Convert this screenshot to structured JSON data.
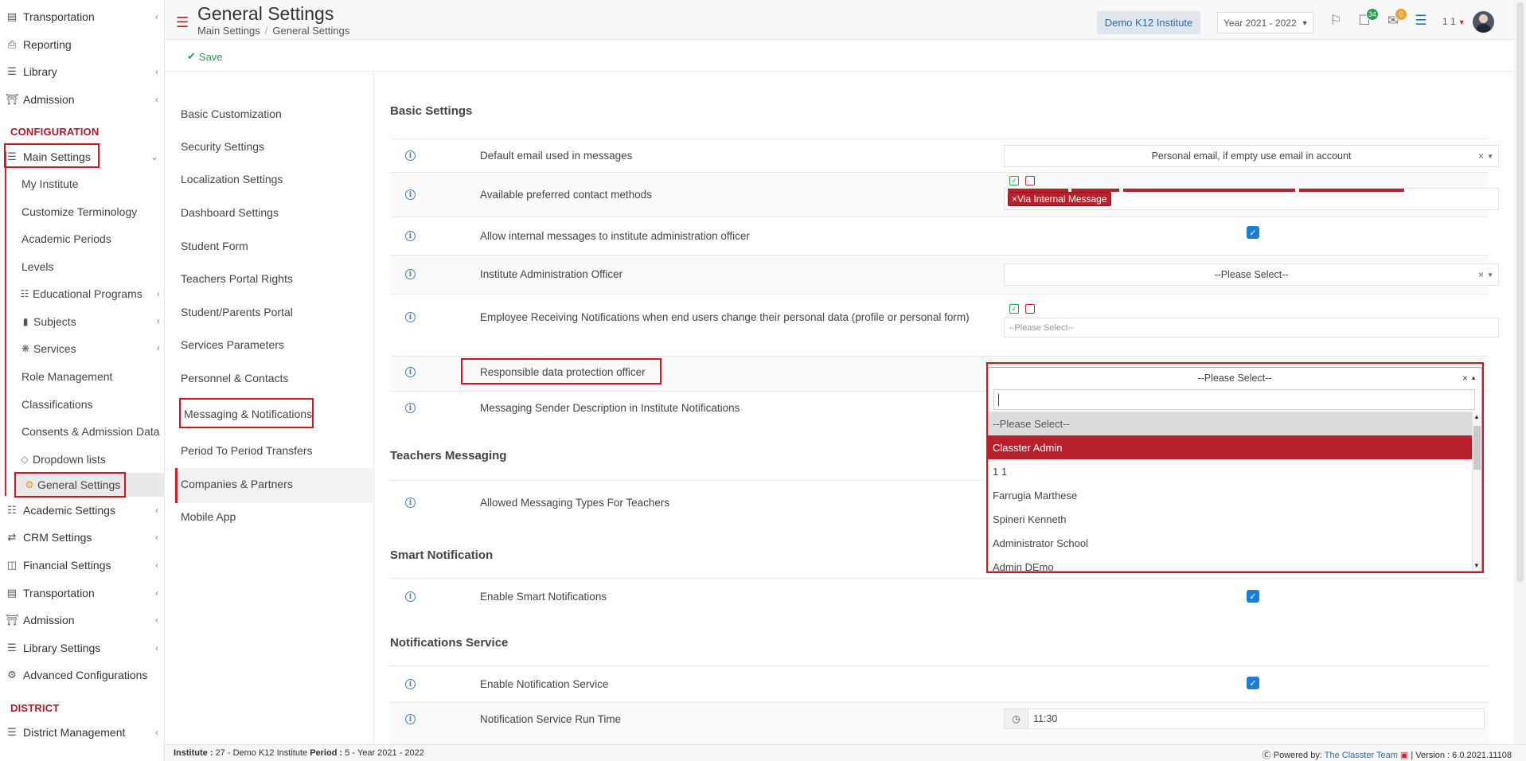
{
  "sidebar": {
    "top_items": [
      {
        "label": "Transportation",
        "icon": "bus-icon"
      },
      {
        "label": "Reporting",
        "icon": "printer-icon"
      },
      {
        "label": "Library",
        "icon": "books-icon"
      },
      {
        "label": "Admission",
        "icon": "institution-icon"
      }
    ],
    "section_configuration": "CONFIGURATION",
    "main_settings_label": "Main Settings",
    "sub_items": [
      "My Institute",
      "Customize Terminology",
      "Academic Periods",
      "Levels",
      "Educational Programs",
      "Subjects",
      "Services",
      "Role Management",
      "Classifications",
      "Consents & Admission Data",
      "Dropdown lists",
      "General Settings"
    ],
    "config_items": [
      "Academic Settings",
      "CRM Settings",
      "Financial Settings",
      "Transportation",
      "Admission",
      "Library Settings",
      "Advanced Configurations"
    ],
    "section_district": "DISTRICT",
    "district_items": [
      "District Management"
    ]
  },
  "header": {
    "title": "General Settings",
    "breadcrumb": [
      "Main Settings",
      "General Settings"
    ],
    "institute": "Demo K12 Institute",
    "year": "Year 2021 - 2022",
    "notifications_count": "34",
    "messages_count": "0",
    "user": "1 1"
  },
  "toolbar": {
    "save_label": "Save"
  },
  "settings_menu": [
    "Basic Customization",
    "Security Settings",
    "Localization Settings",
    "Dashboard Settings",
    "Student Form",
    "Teachers Portal Rights",
    "Student/Parents Portal",
    "Services Parameters",
    "Personnel & Contacts",
    "Messaging & Notifications",
    "Period To Period Transfers",
    "Companies & Partners",
    "Mobile App"
  ],
  "sections": {
    "basic": "Basic Settings",
    "teachers": "Teachers Messaging",
    "smart": "Smart Notification",
    "service": "Notifications Service"
  },
  "rows": {
    "default_email": {
      "label": "Default email used in messages",
      "value": "Personal email, if empty use email in account"
    },
    "contact_methods": {
      "label": "Available preferred contact methods",
      "tag": "Via Internal Message"
    },
    "allow_internal": {
      "label": "Allow internal messages to institute administration officer"
    },
    "admin_officer": {
      "label": "Institute Administration Officer",
      "value": "--Please Select--"
    },
    "employee_notif": {
      "label": "Employee Receiving Notifications when end users change their personal data (profile or personal form)",
      "placeholder": "--Please Select--"
    },
    "dpo": {
      "label": "Responsible data protection officer",
      "value": "--Please Select--"
    },
    "sender_desc": {
      "label": "Messaging Sender Description in Institute Notifications"
    },
    "teacher_types": {
      "label": "Allowed Messaging Types For Teachers"
    },
    "enable_smart": {
      "label": "Enable Smart Notifications"
    },
    "enable_service": {
      "label": "Enable Notification Service"
    },
    "run_time": {
      "label": "Notification Service Run Time",
      "value": "11:30"
    }
  },
  "dropdown_options": [
    "--Please Select--",
    "Classter Admin",
    "1 1",
    "Farrugia Marthese",
    "Spineri Kenneth",
    "Administrator School",
    "Admin DEmo"
  ],
  "footer": {
    "institute_label": "Institute :",
    "institute_value": "27 - Demo K12 Institute",
    "period_label": "Period :",
    "period_value": "5 - Year 2021 - 2022",
    "powered": "Powered by:",
    "team": "The Classter Team",
    "version": "| Version : 6.0.2021.11108"
  },
  "colors": {
    "accent": "#c7252e",
    "highlight": "#b8202c",
    "link": "#2e6ea1",
    "save": "#2b9a4c"
  }
}
